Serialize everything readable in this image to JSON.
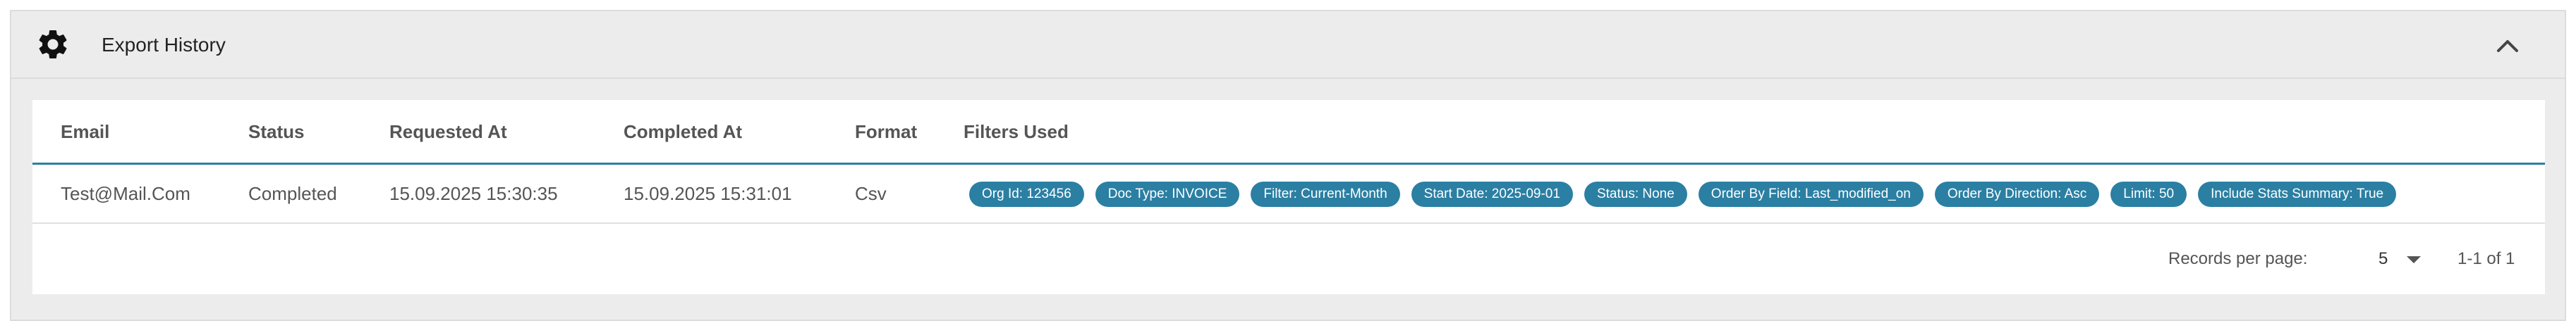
{
  "panel": {
    "title": "Export History",
    "icon": "gear-icon",
    "collapse_icon": "chevron-up-icon"
  },
  "table": {
    "columns": [
      "Email",
      "Status",
      "Requested At",
      "Completed At",
      "Format",
      "Filters Used"
    ],
    "rows": [
      {
        "email": "Test@Mail.Com",
        "status": "Completed",
        "requested_at": "15.09.2025 15:30:35",
        "completed_at": "15.09.2025 15:31:01",
        "format": "Csv",
        "filters": [
          "Org Id: 123456",
          "Doc Type: INVOICE",
          "Filter: Current-Month",
          "Start Date: 2025-09-01",
          "Status: None",
          "Order By Field: Last_modified_on",
          "Order By Direction: Asc",
          "Limit: 50",
          "Include Stats Summary: True"
        ]
      }
    ]
  },
  "pagination": {
    "label": "Records per page:",
    "per_page": "5",
    "range": "1-1 of 1"
  },
  "colors": {
    "accent": "#2b7fa3",
    "header_bg": "#ececec"
  }
}
